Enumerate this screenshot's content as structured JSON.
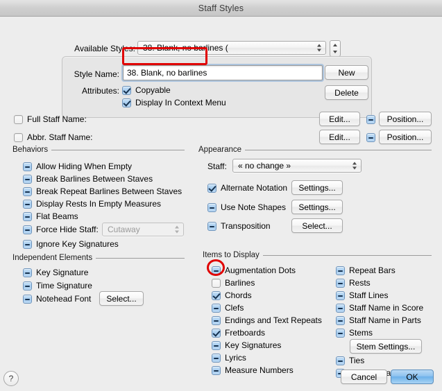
{
  "window": {
    "title": "Staff Styles"
  },
  "available_styles": {
    "label": "Available Styles:",
    "value": "38. Blank, no barlines (",
    "stepper_name": "available-styles-stepper"
  },
  "style_panel": {
    "style_name_label": "Style Name:",
    "style_name_value": "38. Blank, no barlines",
    "attributes_label": "Attributes:",
    "attributes": [
      {
        "label": "Copyable",
        "state": "on"
      },
      {
        "label": "Display In Context Menu",
        "state": "on"
      }
    ],
    "new_button": "New",
    "delete_button": "Delete"
  },
  "names": [
    {
      "key": "full-staff-name",
      "label": "Full Staff Name:",
      "state": "off",
      "edit": "Edit...",
      "position_state": "mixed",
      "position": "Position..."
    },
    {
      "key": "abbr-staff-name",
      "label": "Abbr. Staff Name:",
      "state": "off",
      "edit": "Edit...",
      "position_state": "mixed",
      "position": "Position..."
    }
  ],
  "behaviors": {
    "title": "Behaviors",
    "items": [
      {
        "label": "Allow Hiding When Empty",
        "state": "mixed"
      },
      {
        "label": "Break Barlines Between Staves",
        "state": "mixed"
      },
      {
        "label": "Break Repeat Barlines Between Staves",
        "state": "mixed"
      },
      {
        "label": "Display Rests In Empty Measures",
        "state": "mixed"
      },
      {
        "label": "Flat Beams",
        "state": "mixed"
      },
      {
        "label": "Force Hide Staff:",
        "state": "mixed"
      },
      {
        "label": "Ignore Key Signatures",
        "state": "mixed"
      }
    ],
    "force_hide_value": "Cutaway"
  },
  "independent_elements": {
    "title": "Independent Elements",
    "items": [
      {
        "label": "Key Signature",
        "state": "mixed"
      },
      {
        "label": "Time Signature",
        "state": "mixed"
      },
      {
        "label": "Notehead Font",
        "state": "mixed"
      }
    ],
    "select_button": "Select..."
  },
  "appearance": {
    "title": "Appearance",
    "staff_label": "Staff:",
    "staff_value": "« no change »",
    "rows": [
      {
        "label": "Alternate Notation",
        "state": "on",
        "button": "Settings..."
      },
      {
        "label": "Use Note Shapes",
        "state": "mixed",
        "button": "Settings..."
      },
      {
        "label": "Transposition",
        "state": "mixed",
        "button": "Select..."
      }
    ]
  },
  "items_to_display": {
    "title": "Items to Display",
    "left_column": [
      {
        "label": "Augmentation Dots",
        "state": "mixed"
      },
      {
        "label": "Barlines",
        "state": "off"
      },
      {
        "label": "Chords",
        "state": "on"
      },
      {
        "label": "Clefs",
        "state": "mixed"
      },
      {
        "label": "Endings and Text Repeats",
        "state": "mixed"
      },
      {
        "label": "Fretboards",
        "state": "on"
      },
      {
        "label": "Key Signatures",
        "state": "mixed"
      },
      {
        "label": "Lyrics",
        "state": "mixed"
      },
      {
        "label": "Measure Numbers",
        "state": "mixed"
      }
    ],
    "right_column": [
      {
        "label": "Repeat Bars",
        "state": "mixed"
      },
      {
        "label": "Rests",
        "state": "mixed"
      },
      {
        "label": "Staff Lines",
        "state": "mixed"
      },
      {
        "label": "Staff Name in Score",
        "state": "mixed"
      },
      {
        "label": "Staff Name in Parts",
        "state": "mixed"
      },
      {
        "label": "Stems",
        "state": "mixed"
      },
      {
        "label": "Ties",
        "state": "mixed"
      },
      {
        "label": "Time Signatures",
        "state": "mixed"
      }
    ],
    "stem_settings_button": "Stem Settings..."
  },
  "footer": {
    "help_glyph": "?",
    "cancel": "Cancel",
    "ok": "OK"
  },
  "annotations": {
    "accent_color": "#e00000",
    "style_name_highlight": "rectangle around Style Name value",
    "barlines_highlight": "circle around Barlines checkbox"
  }
}
